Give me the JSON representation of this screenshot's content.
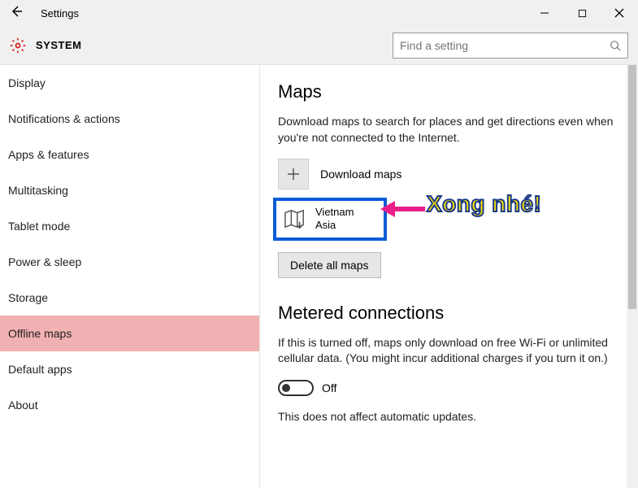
{
  "titlebar": {
    "title": "Settings"
  },
  "header": {
    "section": "SYSTEM",
    "search_placeholder": "Find a setting"
  },
  "sidebar": {
    "items": [
      {
        "label": "Display",
        "selected": false
      },
      {
        "label": "Notifications & actions",
        "selected": false
      },
      {
        "label": "Apps & features",
        "selected": false
      },
      {
        "label": "Multitasking",
        "selected": false
      },
      {
        "label": "Tablet mode",
        "selected": false
      },
      {
        "label": "Power & sleep",
        "selected": false
      },
      {
        "label": "Storage",
        "selected": false
      },
      {
        "label": "Offline maps",
        "selected": true
      },
      {
        "label": "Default apps",
        "selected": false
      },
      {
        "label": "About",
        "selected": false
      }
    ]
  },
  "main": {
    "maps_heading": "Maps",
    "maps_desc": "Download maps to search for places and get directions even when you're not connected to the Internet.",
    "download_label": "Download maps",
    "downloaded_map": {
      "name": "Vietnam",
      "region": "Asia"
    },
    "delete_label": "Delete all maps",
    "metered_heading": "Metered connections",
    "metered_desc": "If this is turned off, maps only download on free Wi-Fi or unlimited cellular data. (You might incur additional charges if you turn it on.)",
    "toggle_state": "Off",
    "metered_note": "This does not affect automatic updates."
  },
  "annotation": {
    "text": "Xong nhé!"
  }
}
